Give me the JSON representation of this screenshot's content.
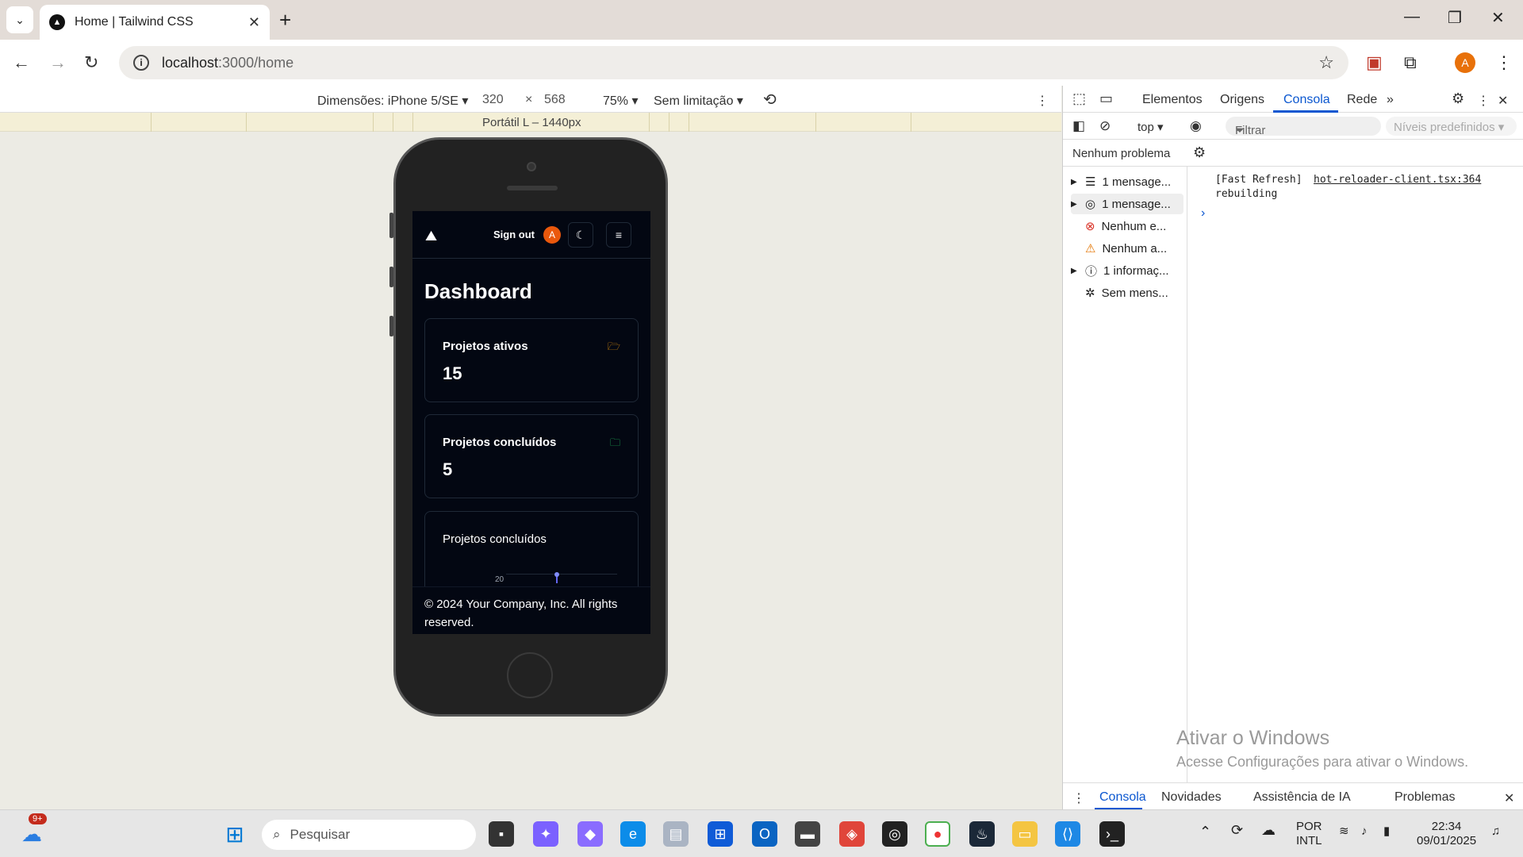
{
  "browser": {
    "tab_title": "Home | Tailwind CSS",
    "url_host": "localhost",
    "url_rest": ":3000/home",
    "profile_initial": "A"
  },
  "device_toolbar": {
    "dimensions": "Dimensões: iPhone 5/SE ▾",
    "width": "320",
    "times": "×",
    "height": "568",
    "zoom": "75% ▾",
    "throttle": "Sem limitação ▾",
    "breakpoint": "Portátil L – 1440px"
  },
  "app": {
    "signout": "Sign out",
    "avatar_initial": "A",
    "title": "Dashboard",
    "cards": [
      {
        "title": "Projetos ativos",
        "value": "15",
        "icon_color": "#f59e0b"
      },
      {
        "title": "Projetos concluídos",
        "value": "5",
        "icon_color": "#22c55e"
      }
    ],
    "chart_card_title": "Projetos concluídos",
    "chart_tick": "20",
    "footer": "© 2024 Your Company, Inc. All rights reserved."
  },
  "devtools": {
    "tabs": [
      "Elementos",
      "Origens",
      "Consola",
      "Rede"
    ],
    "context": "top ▾",
    "filter_placeholder": "Filtrar",
    "levels": "Níveis predefinidos ▾",
    "issues": "Nenhum problema",
    "sidebar": [
      {
        "label": "1 mensage...",
        "icon": "list-icon",
        "arrow": "▶"
      },
      {
        "label": "1 mensage...",
        "icon": "user-icon",
        "arrow": "▶"
      },
      {
        "label": "Nenhum e...",
        "icon": "error-icon",
        "arrow": ""
      },
      {
        "label": "Nenhum a...",
        "icon": "warning-icon",
        "arrow": ""
      },
      {
        "label": "1 informaç...",
        "icon": "info-icon",
        "arrow": "▶"
      },
      {
        "label": "Sem mens...",
        "icon": "bug-icon",
        "arrow": ""
      }
    ],
    "log_prefix": "[Fast Refresh]",
    "log_source": "hot-reloader-client.tsx:364",
    "log_text": "rebuilding",
    "watermark_title": "Ativar o Windows",
    "watermark_sub": "Acesse Configurações para ativar o Windows.",
    "drawer_tabs": [
      "Consola",
      "Novidades",
      "Assistência de IA",
      "Problemas"
    ]
  },
  "taskbar": {
    "weather_badge": "9+",
    "search_placeholder": "Pesquisar",
    "lang1": "POR",
    "lang2": "INTL",
    "time": "22:34",
    "date": "09/01/2025"
  }
}
